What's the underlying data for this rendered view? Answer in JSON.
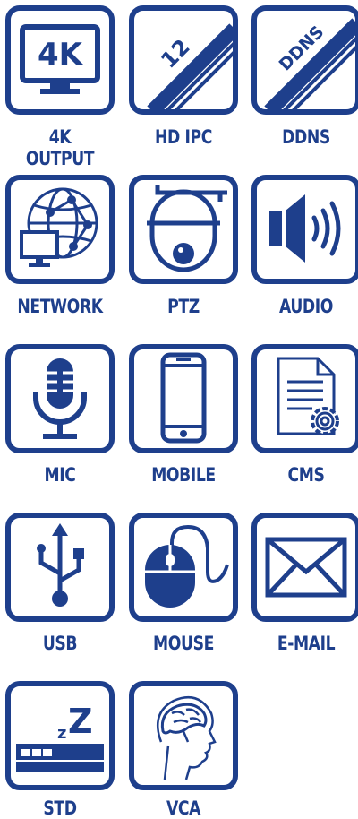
{
  "colors": {
    "icon_blue": "#1e3f8c",
    "background": "#ffffff"
  },
  "features": [
    {
      "label": "4K OUTPUT",
      "icon": "monitor-4k-icon",
      "badge": "4K"
    },
    {
      "label": "HD IPC",
      "icon": "cable-12-icon",
      "badge": "12"
    },
    {
      "label": "DDNS",
      "icon": "cable-ddns-icon",
      "badge": "DDNS"
    },
    {
      "label": "NETWORK",
      "icon": "network-globe-icon"
    },
    {
      "label": "PTZ",
      "icon": "ptz-dome-camera-icon"
    },
    {
      "label": "AUDIO",
      "icon": "speaker-icon"
    },
    {
      "label": "MIC",
      "icon": "microphone-icon"
    },
    {
      "label": "MOBILE",
      "icon": "smartphone-icon"
    },
    {
      "label": "CMS",
      "icon": "document-gear-icon"
    },
    {
      "label": "USB",
      "icon": "usb-icon"
    },
    {
      "label": "MOUSE",
      "icon": "mouse-icon"
    },
    {
      "label": "E-MAIL",
      "icon": "envelope-icon"
    },
    {
      "label": "STD",
      "icon": "standby-zz-icon",
      "badge": "Z",
      "badge_small": "z"
    },
    {
      "label": "VCA",
      "icon": "head-brain-icon"
    }
  ]
}
